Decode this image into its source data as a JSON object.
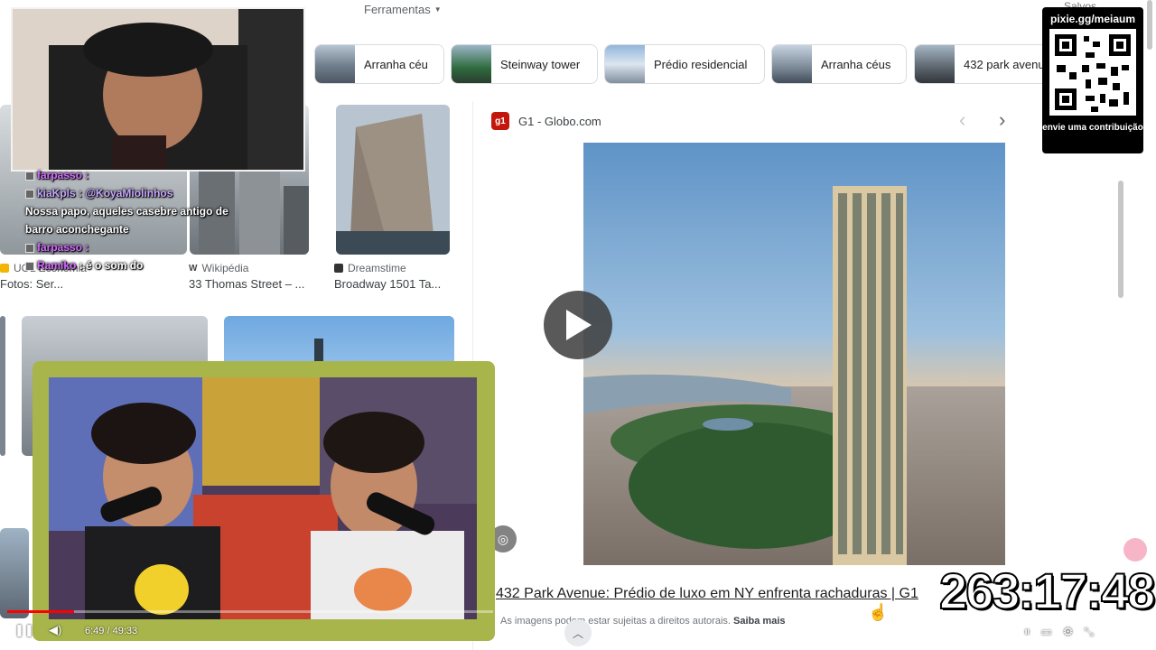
{
  "toolbar": {
    "tools_label": "Ferramentas",
    "saved_label": "Salvos"
  },
  "chips": [
    {
      "label": "Arranha céu"
    },
    {
      "label": "Steinway tower"
    },
    {
      "label": "Prédio residencial"
    },
    {
      "label": "Arranha céus"
    },
    {
      "label": "432 park avenue"
    }
  ],
  "results": [
    {
      "source": "UOL Economia",
      "title": "Fotos: Ser..."
    },
    {
      "source": "Wikipédia",
      "title": "33 Thomas Street – ..."
    },
    {
      "source": "Dreamstime",
      "title": "Broadway 1501 Ta..."
    }
  ],
  "panel": {
    "source": "G1 - Globo.com",
    "source_badge": "g1",
    "article_title": "432 Park Avenue: Prédio de luxo em NY enfrenta rachaduras | G1",
    "copyright_text": "As imagens podem estar sujeitas a direitos autorais.",
    "learn_more": "Saiba mais"
  },
  "stream": {
    "qr_url": "pixie.gg/meiaum",
    "qr_caption": "envie uma contribuição",
    "timer": "263:17:48",
    "chat": [
      {
        "user": "farpasso",
        "text": ""
      },
      {
        "user": "kiaKpls",
        "text": "@KoyaMiolinhos"
      },
      {
        "user": "",
        "text": "Nossa papo, aqueles casebre antigo de barro aconchegante"
      },
      {
        "user": "farpasso",
        "text": ""
      },
      {
        "user": "Ramiko",
        "text": "é o som do"
      }
    ]
  },
  "player": {
    "time": "6:49 / 49:33",
    "progress": 0.137
  },
  "colors": {
    "g1_red": "#c4170c",
    "progress_red": "#ff0000",
    "frame_green": "#a8b54a"
  }
}
